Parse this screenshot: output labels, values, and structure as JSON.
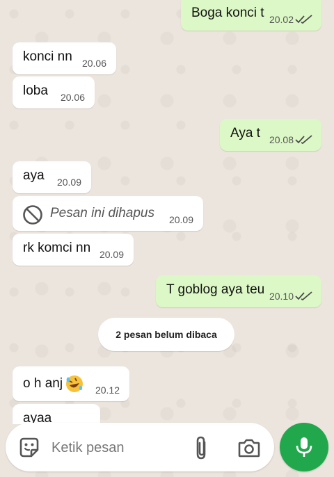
{
  "messages": [
    {
      "dir": "out",
      "text": "Boga konci t",
      "time": "20.02",
      "status": "read"
    },
    {
      "dir": "in",
      "text": "konci nn",
      "time": "20.06"
    },
    {
      "dir": "in",
      "text": "loba",
      "time": "20.06"
    },
    {
      "dir": "out",
      "text": "Aya t",
      "time": "20.08",
      "status": "read"
    },
    {
      "dir": "in",
      "text": "aya",
      "time": "20.09"
    },
    {
      "dir": "in",
      "deleted": true,
      "text": "Pesan ini dihapus",
      "time": "20.09"
    },
    {
      "dir": "in",
      "text": "rk komci nn",
      "time": "20.09"
    },
    {
      "dir": "out",
      "text": "T goblog aya teu",
      "time": "20.10",
      "status": "read"
    },
    {
      "dir": "in",
      "text": "o h anj",
      "emoji": "rolling-on-floor-laughing",
      "time": "20.12"
    },
    {
      "dir": "in",
      "text": "ayaa",
      "time": ""
    }
  ],
  "unread_banner": "2 pesan belum dibaca",
  "composer": {
    "placeholder": "Ketik pesan",
    "value": ""
  },
  "icons": {
    "emoji_button": "emoji-face-icon",
    "attach": "paperclip-icon",
    "camera": "camera-icon",
    "mic": "microphone-icon",
    "read_ticks": "double-check-icon",
    "deleted": "no-entry-icon"
  },
  "colors": {
    "background": "#ece5dd",
    "incoming_bubble": "#ffffff",
    "outgoing_bubble": "#dcf8c6",
    "tick_color": "#4a4a4a",
    "mic_button": "#21a84d"
  }
}
